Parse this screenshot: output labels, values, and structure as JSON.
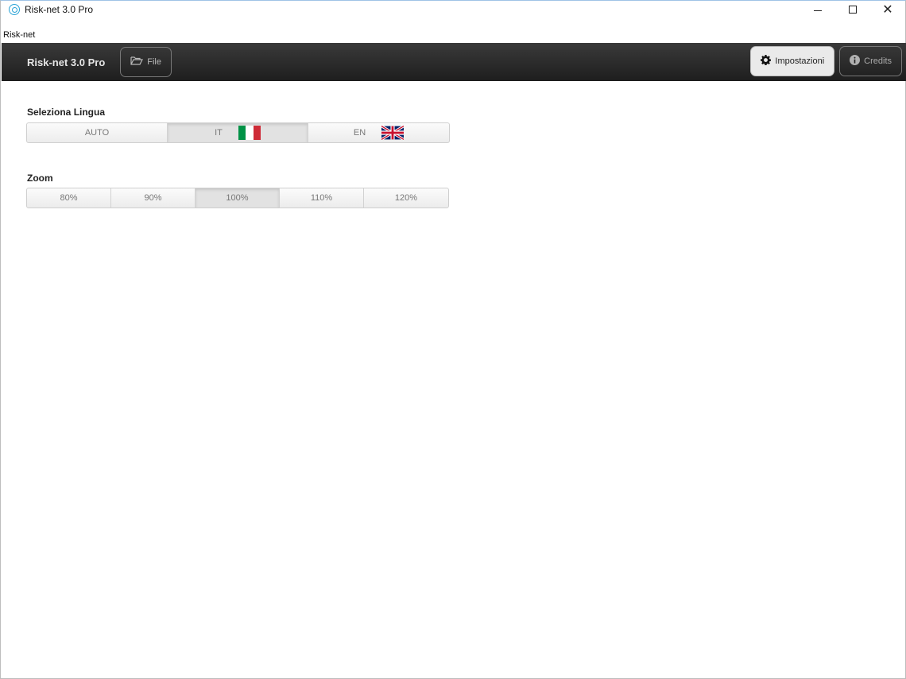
{
  "window": {
    "title": "Risk-net 3.0 Pro",
    "menu": "Risk-net"
  },
  "toolbar": {
    "brand": "Risk-net 3.0 Pro",
    "file_label": "File",
    "settings_label": "Impostazioni",
    "credits_label": "Credits"
  },
  "language": {
    "label": "Seleziona Lingua",
    "options": [
      "AUTO",
      "IT",
      "EN"
    ],
    "selected": "IT"
  },
  "zoom": {
    "label": "Zoom",
    "options": [
      "80%",
      "90%",
      "100%",
      "110%",
      "120%"
    ],
    "selected": "100%"
  },
  "icons": {
    "app": "app-logo-icon",
    "file": "folder-open-icon",
    "settings": "gear-icon",
    "credits": "info-icon",
    "it_flag": "italy-flag-icon",
    "en_flag": "uk-flag-icon"
  },
  "colors": {
    "toolbar": "#2a2a2a",
    "flag_it_green": "#009246",
    "flag_it_white": "#ffffff",
    "flag_it_red": "#ce2b37",
    "flag_uk_blue": "#012169",
    "flag_uk_red": "#c8102e"
  }
}
